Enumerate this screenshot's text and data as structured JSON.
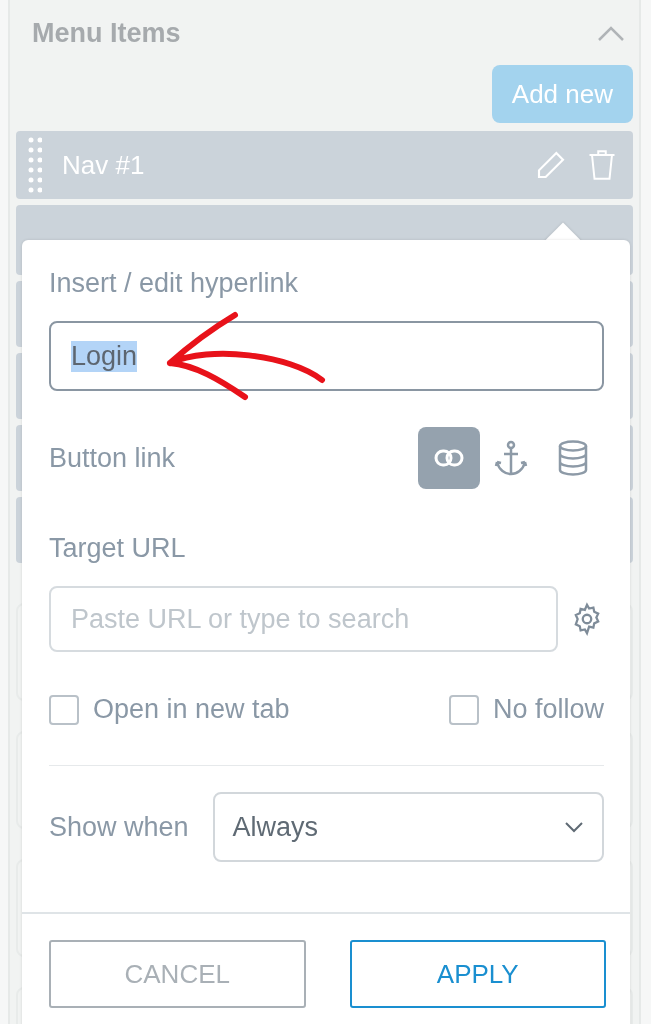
{
  "panel": {
    "title": "Menu Items",
    "expanded": true,
    "add_button": "Add new"
  },
  "nav_items": [
    {
      "label": "Nav #1"
    }
  ],
  "popover": {
    "title": "Insert / edit hyperlink",
    "text_field": {
      "value": "Login",
      "highlighted": true
    },
    "link_type": {
      "label": "Button link",
      "options": [
        {
          "kind": "link",
          "selected": true
        },
        {
          "kind": "anchor",
          "selected": false
        },
        {
          "kind": "database",
          "selected": false
        }
      ]
    },
    "target": {
      "label": "Target URL",
      "placeholder": "Paste URL or type to search"
    },
    "checkboxes": [
      {
        "label": "Open in new tab",
        "checked": false
      },
      {
        "label": "No follow",
        "checked": false
      }
    ],
    "show_when": {
      "label": "Show when",
      "value": "Always"
    },
    "buttons": [
      {
        "label": "CANCEL",
        "kind": "secondary"
      },
      {
        "label": "APPLY",
        "kind": "primary"
      }
    ]
  }
}
